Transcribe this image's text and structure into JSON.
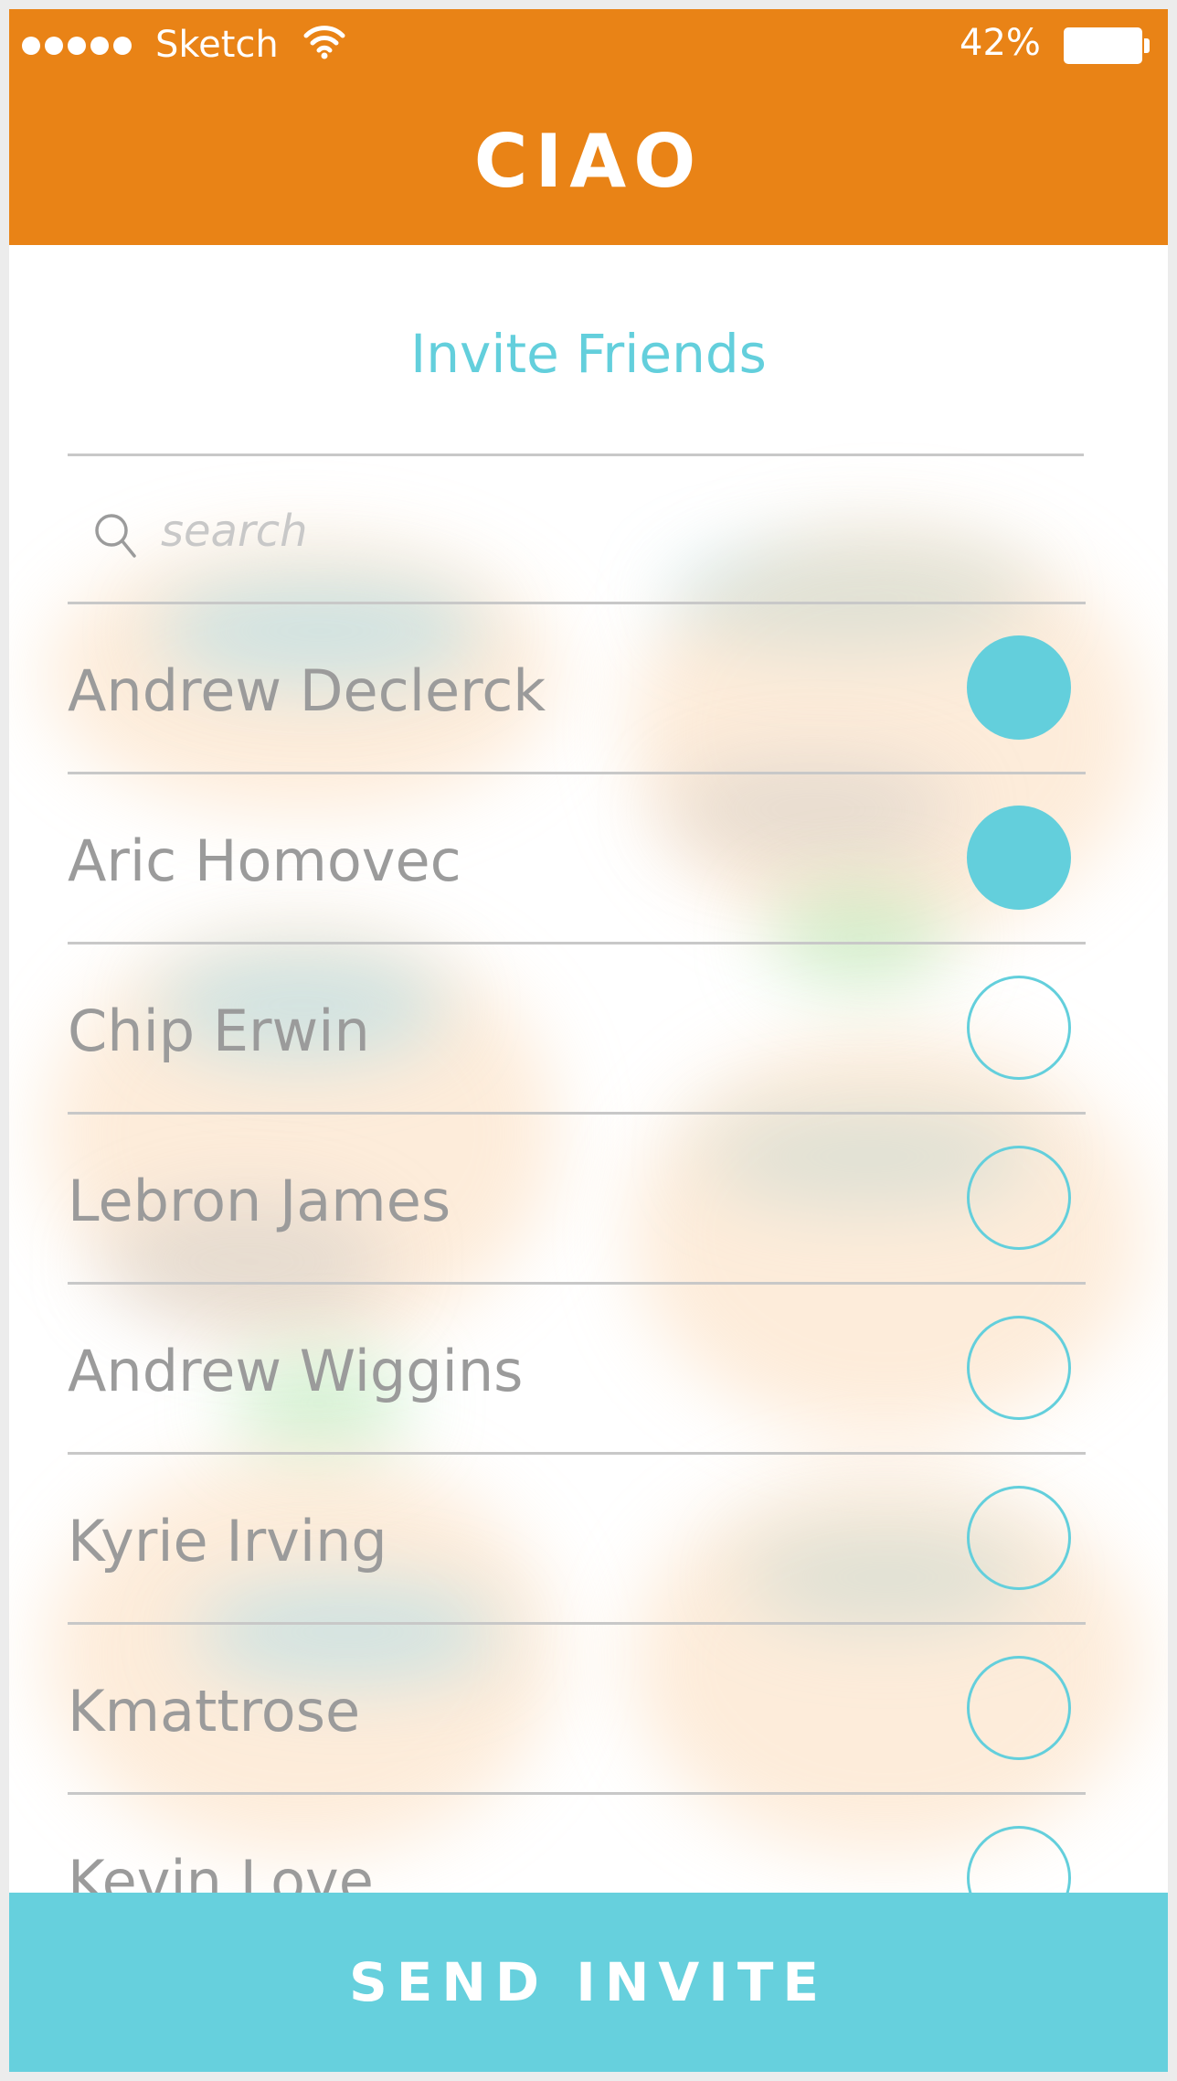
{
  "status_bar": {
    "carrier": "Sketch",
    "battery": "42%"
  },
  "app": {
    "title": "CIAO"
  },
  "invite": {
    "heading": "Invite Friends",
    "search_placeholder": "search"
  },
  "friends": [
    {
      "name": "Andrew Declerck",
      "selected": true
    },
    {
      "name": "Aric Homovec",
      "selected": true
    },
    {
      "name": "Chip Erwin",
      "selected": false
    },
    {
      "name": "Lebron James",
      "selected": false
    },
    {
      "name": "Andrew Wiggins",
      "selected": false
    },
    {
      "name": "Kyrie Irving",
      "selected": false
    },
    {
      "name": "Kmattrose",
      "selected": false
    },
    {
      "name": "Kevin Love",
      "selected": false
    }
  ],
  "actions": {
    "send_label": "SEND INVITE"
  },
  "colors": {
    "header": "#e98316",
    "accent": "#63cfdc",
    "button": "#66d0dd"
  }
}
